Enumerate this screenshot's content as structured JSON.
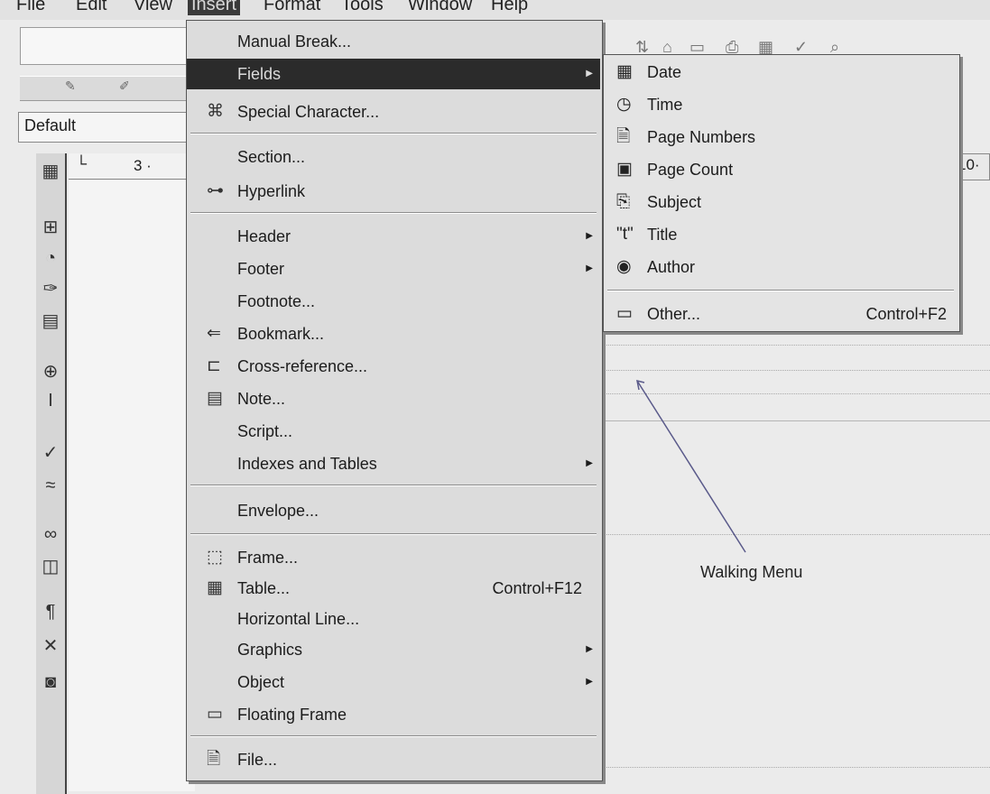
{
  "menubar": {
    "items": [
      {
        "label": "File"
      },
      {
        "label": "Edit"
      },
      {
        "label": "View"
      },
      {
        "label": "Insert"
      },
      {
        "label": "Format"
      },
      {
        "label": "Tools"
      },
      {
        "label": "Window"
      },
      {
        "label": "Help"
      }
    ]
  },
  "style_box": {
    "value": "Default"
  },
  "ruler": {
    "left_text": "3 ·",
    "right_text": "10·"
  },
  "insert_menu": {
    "items": [
      {
        "label": "Manual Break...",
        "icon": ""
      },
      {
        "label": "Fields",
        "icon": "",
        "submenu": true,
        "highlighted": true
      },
      {
        "label": "Special Character...",
        "icon": "⌘"
      },
      {
        "label": "Section...",
        "icon": ""
      },
      {
        "label": "Hyperlink",
        "icon": "⊶"
      },
      {
        "label": "Header",
        "icon": "",
        "submenu": true
      },
      {
        "label": "Footer",
        "icon": "",
        "submenu": true
      },
      {
        "label": "Footnote...",
        "icon": ""
      },
      {
        "label": "Bookmark...",
        "icon": "⇐"
      },
      {
        "label": "Cross-reference...",
        "icon": "⊏"
      },
      {
        "label": "Note...",
        "icon": "▤"
      },
      {
        "label": "Script...",
        "icon": ""
      },
      {
        "label": "Indexes and Tables",
        "icon": "",
        "submenu": true
      },
      {
        "label": "Envelope...",
        "icon": ""
      },
      {
        "label": "Frame...",
        "icon": "⬚"
      },
      {
        "label": "Table...",
        "icon": "▦",
        "shortcut": "Control+F12"
      },
      {
        "label": "Horizontal Line...",
        "icon": ""
      },
      {
        "label": "Graphics",
        "icon": "",
        "submenu": true
      },
      {
        "label": "Object",
        "icon": "",
        "submenu": true
      },
      {
        "label": "Floating Frame",
        "icon": "▭"
      },
      {
        "label": "File...",
        "icon": "🗎"
      }
    ]
  },
  "fields_menu": {
    "items": [
      {
        "label": "Date",
        "icon": "▦"
      },
      {
        "label": "Time",
        "icon": "◷"
      },
      {
        "label": "Page Numbers",
        "icon": "🗎"
      },
      {
        "label": "Page Count",
        "icon": "▣"
      },
      {
        "label": "Subject",
        "icon": "⎘"
      },
      {
        "label": "Title",
        "icon": "\"t\""
      },
      {
        "label": "Author",
        "icon": "◉"
      },
      {
        "label": "Other...",
        "icon": "▭",
        "shortcut": "Control+F2"
      }
    ]
  },
  "annotation": {
    "label": "Walking Menu"
  }
}
